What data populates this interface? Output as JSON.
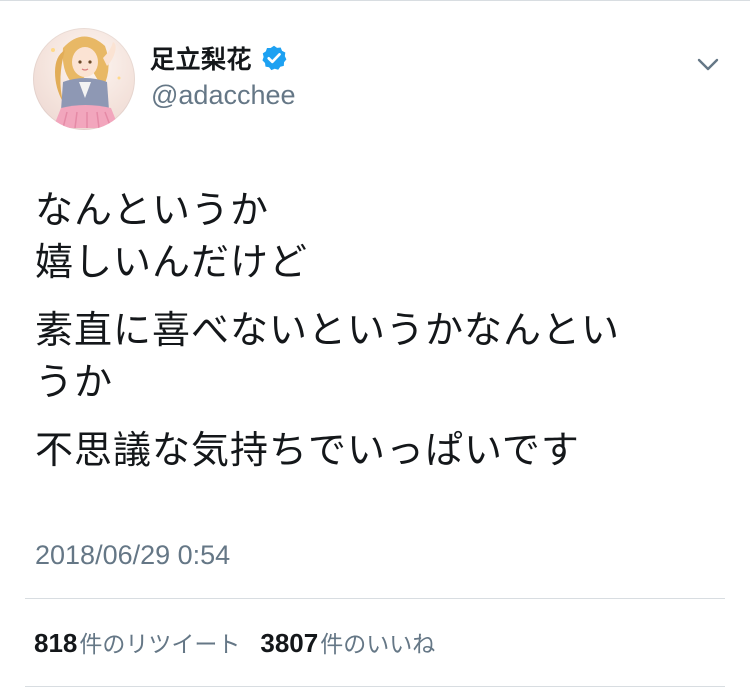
{
  "author": {
    "display_name": "足立梨花",
    "handle": "@adacchee",
    "verified": true,
    "avatar_icon": "avatar-illustration"
  },
  "tweet": {
    "paragraphs": [
      "なんというか\n嬉しいんだけど",
      "素直に喜べないというかなんとい\nうか",
      "不思議な気持ちでいっぱいです"
    ],
    "timestamp": "2018/06/29 0:54"
  },
  "stats": {
    "retweets_count": "818",
    "retweets_label": "件のリツイート",
    "likes_count": "3807",
    "likes_label": "件のいいね"
  },
  "colors": {
    "text_primary": "#14171a",
    "text_secondary": "#657786",
    "verified_blue": "#1da1f2",
    "divider": "#d8dde1"
  },
  "icons": {
    "verified": "verified-badge-icon",
    "menu": "chevron-down-icon"
  }
}
